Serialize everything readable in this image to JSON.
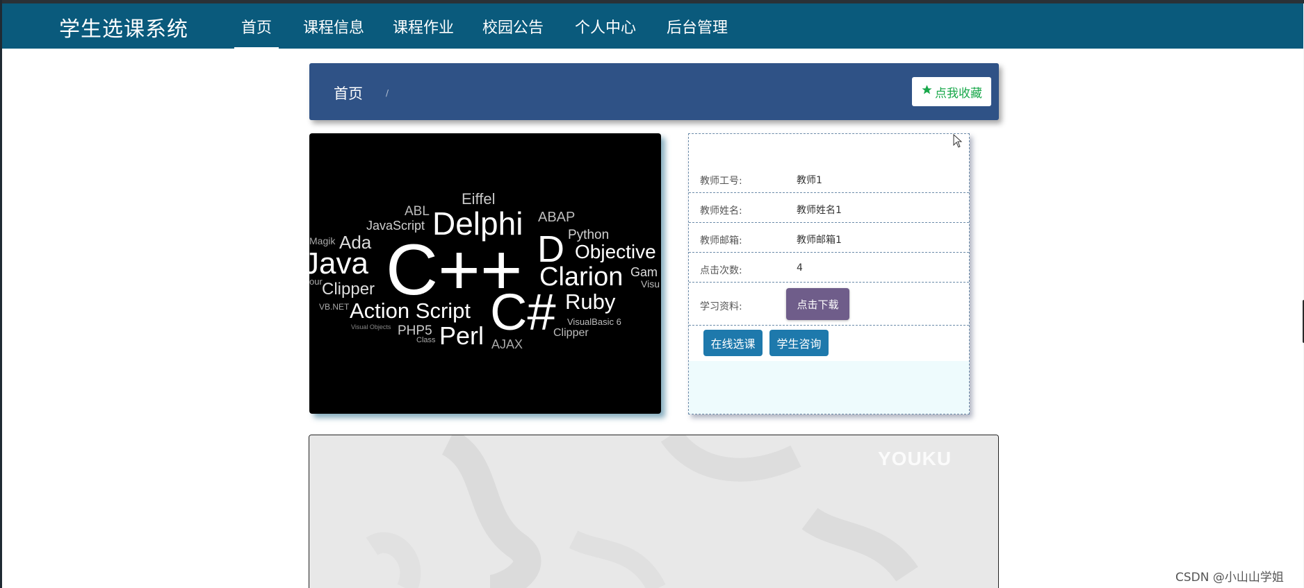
{
  "nav": {
    "brand": "学生选课系统",
    "items": [
      {
        "label": "首页",
        "active": true
      },
      {
        "label": "课程信息"
      },
      {
        "label": "课程作业"
      },
      {
        "label": "校园公告"
      },
      {
        "label": "个人中心"
      },
      {
        "label": "后台管理"
      }
    ]
  },
  "breadcrumb": {
    "home": "首页",
    "separator": "/"
  },
  "favorite": {
    "label": "点我收藏",
    "icon": "star-icon",
    "color": "#18a84a"
  },
  "course_image": {
    "words": {
      "w1": "Eiffel",
      "w2": "ABL",
      "w3": "JavaScript",
      "w4": "Delphi",
      "w5": "ABAP",
      "w6": "Python",
      "w7": "D",
      "w8": "Objective",
      "w9": "Magik",
      "w10": "Ada",
      "w11": "Java",
      "w12": "C++",
      "w13": "Clarion",
      "w14": "Gam",
      "w15": "Visu",
      "w16": "our",
      "w17": "Clipper",
      "w18": "C#",
      "w19": "Ruby",
      "w20": "VB.NET",
      "w21": "Action Script",
      "w22": "VisualBasic 6",
      "w23": "Visual Objects",
      "w24": "PHP5",
      "w25": "Perl",
      "w26": "Clipper",
      "w27": "Class",
      "w28": "AJAX"
    }
  },
  "teacher": {
    "id_label": "教师工号:",
    "id_value": "教师1",
    "name_label": "教师姓名:",
    "name_value": "教师姓名1",
    "email_label": "教师邮箱:",
    "email_value": "教师邮箱1",
    "clicks_label": "点击次数:",
    "clicks_value": "4",
    "material_label": "学习资料:",
    "download_label": "点击下载"
  },
  "actions": {
    "enroll": "在线选课",
    "consult": "学生咨询"
  },
  "video": {
    "logo": "YOUKU"
  },
  "watermark": "CSDN @小山山学姐",
  "colors": {
    "navbar": "#0a5a7c",
    "breadcrumb_bar": "#2f5286",
    "action_button": "#1e79ac",
    "download_button": "#6f5d8a"
  }
}
